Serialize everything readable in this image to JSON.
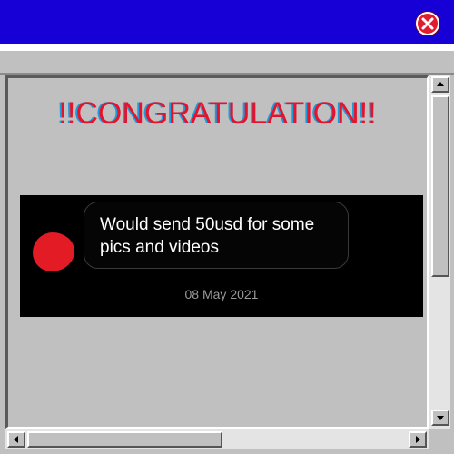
{
  "window": {
    "title_bar_color": "#1600d6",
    "close_icon": "close-x-icon"
  },
  "headline": {
    "text": "!!CONGRATULATION!!",
    "color": "#e5122c",
    "shadow_color": "#1e9bd8"
  },
  "chat": {
    "message": "Would send 50usd for some pics and videos",
    "timestamp": "08 May 2021",
    "avatar": "redacted-avatar"
  },
  "scrollbars": {
    "vertical": {
      "position_fraction": 0.0
    },
    "horizontal": {
      "position_fraction": 0.0
    }
  }
}
